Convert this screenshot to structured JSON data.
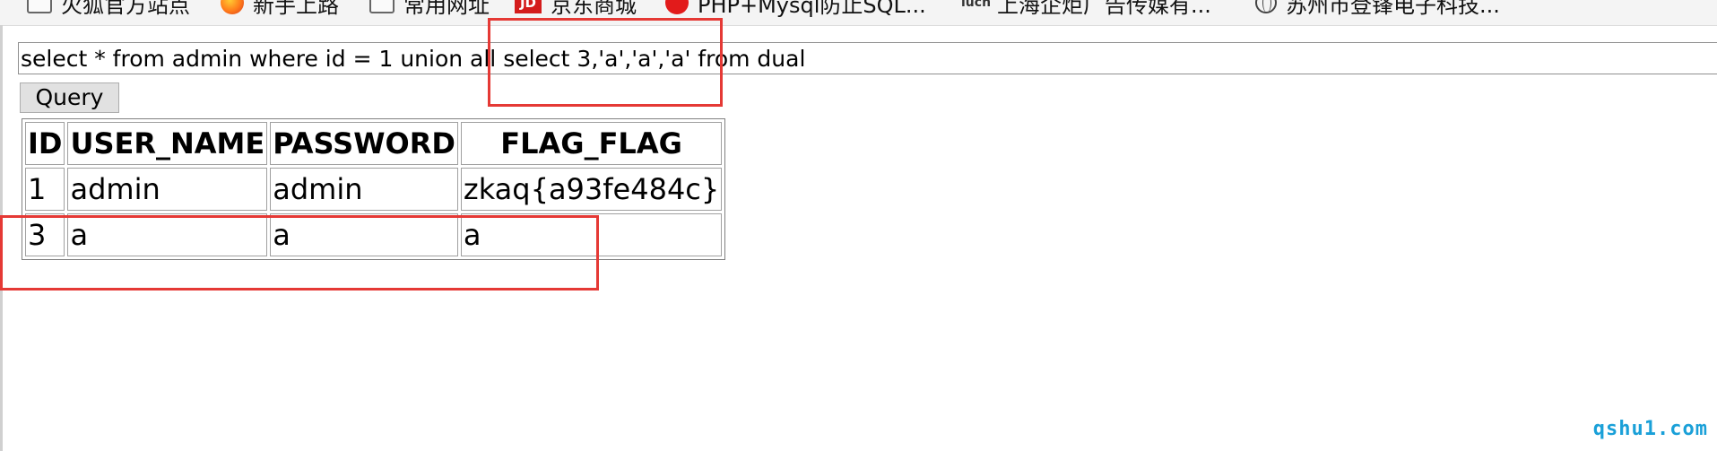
{
  "bookmarks": [
    {
      "label": "火狐官方站点",
      "icon": "folder-icon"
    },
    {
      "label": "新手上路",
      "icon": "firefox-icon"
    },
    {
      "label": "常用网址",
      "icon": "folder-icon"
    },
    {
      "label": "京东商城",
      "icon": "jd-icon"
    },
    {
      "label": "PHP+Mysql防止SQL...",
      "icon": "php-icon"
    },
    {
      "label": "上海企炬广告传媒有...",
      "icon": "iucn-icon"
    },
    {
      "label": "苏州市登锋电子科技...",
      "icon": "globe-icon"
    }
  ],
  "query": {
    "value": "select * from admin where id = 1 union all select 3,'a','a','a' from dual",
    "button_label": "Query"
  },
  "table": {
    "headers": [
      "ID",
      "USER_NAME",
      "PASSWORD",
      "FLAG_FLAG"
    ],
    "rows": [
      [
        "1",
        "admin",
        "admin",
        "zkaq{a93fe484c}"
      ],
      [
        "3",
        "a",
        "a",
        "a"
      ]
    ]
  },
  "watermark": "qshu1.com",
  "colors": {
    "annotation": "#e53935",
    "watermark": "#1aa0d8"
  }
}
